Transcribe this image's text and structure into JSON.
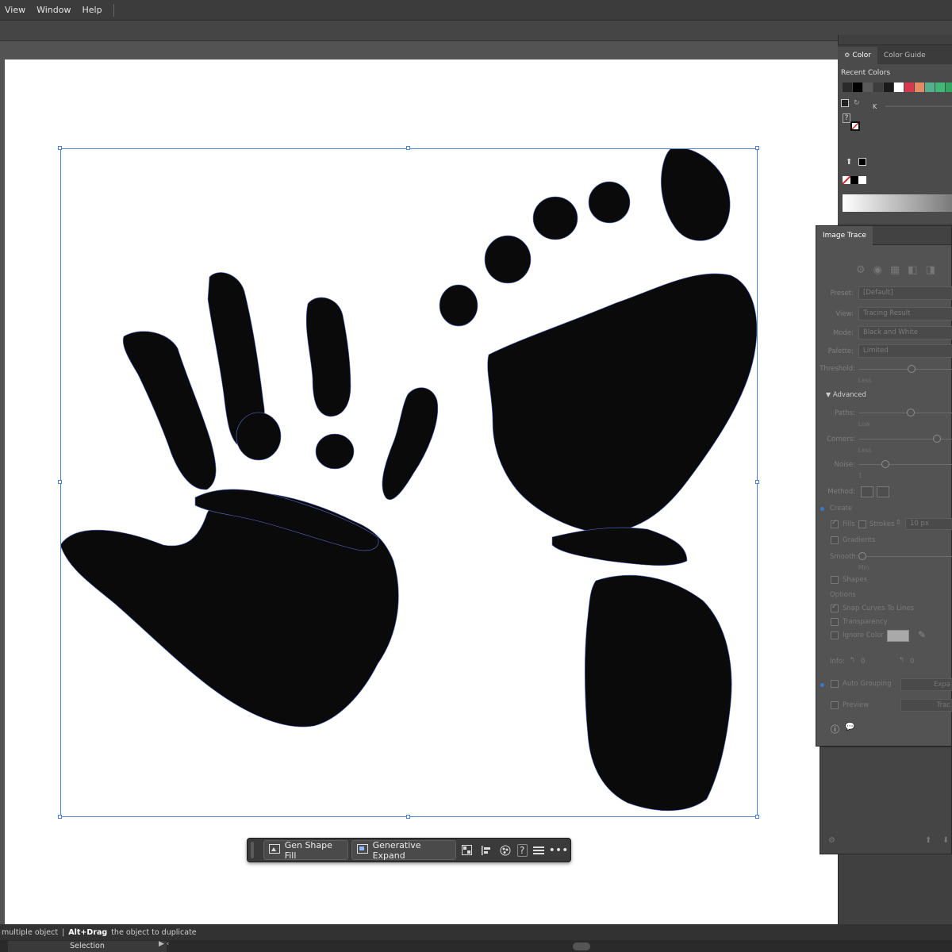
{
  "menu": {
    "items": [
      "View",
      "Window",
      "Help"
    ]
  },
  "color_panel": {
    "tabs": [
      "Color",
      "Color Guide"
    ],
    "active_tab": "Color",
    "tab_marker": "≎",
    "recent_label": "Recent Colors",
    "recent_colors": [
      "#2a2a2a",
      "#000000",
      "#5a5a5a",
      "#3d3d3d",
      "#1a1a1a",
      "#ffffff",
      "#d4394f",
      "#e58b63",
      "#56b08f",
      "#42b877",
      "#31a861"
    ],
    "k_label": "K",
    "question": "?"
  },
  "image_trace": {
    "title": "Image Trace",
    "preset_label": "Preset:",
    "preset_value": "[Default]",
    "view_label": "View:",
    "view_value": "Tracing Result",
    "mode_label": "Mode:",
    "mode_value": "Black and White",
    "palette_label": "Palette:",
    "palette_value": "Limited",
    "threshold_label": "Threshold:",
    "threshold_min": "Less",
    "advanced_label": "Advanced",
    "paths_label": "Paths:",
    "paths_min": "Low",
    "corners_label": "Corners:",
    "corners_min": "Less",
    "noise_label": "Noise:",
    "noise_min": "1",
    "method_label": "Method:",
    "create_label": "Create",
    "fills_label": "Fills",
    "strokes_label": "Strokes",
    "strokes_value": "10 px",
    "gradients_label": "Gradients",
    "smooth_label": "Smooth:",
    "smooth_min": "Min",
    "shapes_label": "Shapes",
    "options_label": "Options",
    "snap_label": "Snap Curves To Lines",
    "transparency_label": "Transparency",
    "ignore_color_label": "Ignore Color",
    "info_label": "Info:",
    "info_paths": "0",
    "info_anchors": "0",
    "auto_grouping_label": "Auto Grouping",
    "expand_label": "Expa",
    "preview_label": "Preview",
    "trace_label": "Trac"
  },
  "taskbar": {
    "gen_shape_fill": "Gen Shape Fill",
    "generative_expand": "Generative Expand",
    "help": "?",
    "more": "•••"
  },
  "status": {
    "hint_pre": "multiple object",
    "divider": "|",
    "hint_key": "Alt+Drag",
    "hint_post": "the object to duplicate",
    "tool": "Selection"
  }
}
